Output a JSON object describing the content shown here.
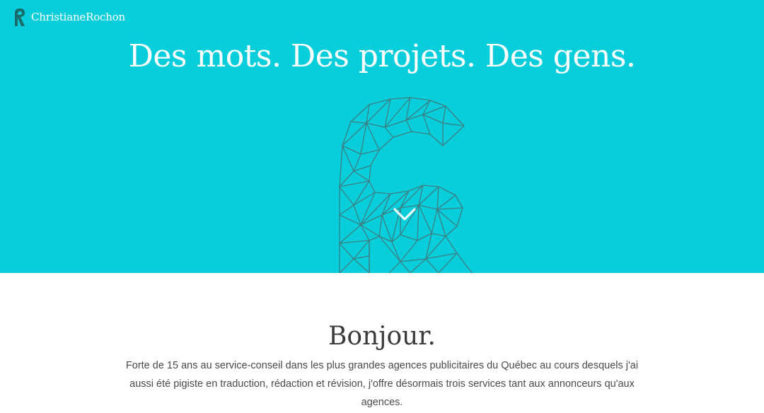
{
  "brand": {
    "name": "ChristianeRochon",
    "logo_icon": "r-monogram-icon",
    "logo_color": "#1a6b6b"
  },
  "hero": {
    "title": "Des mots. Des projets. Des gens.",
    "background_color": "#08cedb",
    "emblem_icon": "geometric-r-icon",
    "scroll_icon": "chevron-down-icon"
  },
  "intro": {
    "title": "Bonjour.",
    "text": "Forte de 15 ans au service-conseil dans les plus grandes agences publicitaires du Québec au cours desquels j'ai aussi été pigiste en traduction, rédaction et révision, j'offre désormais trois services tant aux annonceurs qu'aux agences."
  }
}
